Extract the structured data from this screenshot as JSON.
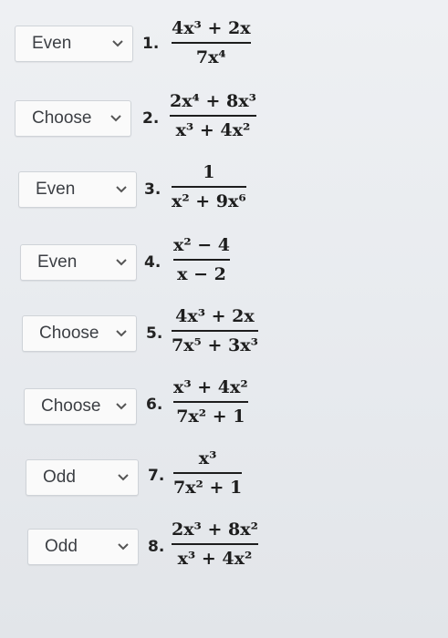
{
  "questions": [
    {
      "number": "1.",
      "answer": "Even",
      "numerator": "4x³ + 2x",
      "denominator": "7x⁴"
    },
    {
      "number": "2.",
      "answer": "Choose",
      "numerator": "2x⁴ + 8x³",
      "denominator": "x³ + 4x²"
    },
    {
      "number": "3.",
      "answer": "Even",
      "numerator": "1",
      "denominator": "x² + 9x⁶"
    },
    {
      "number": "4.",
      "answer": "Even",
      "numerator": "x² − 4",
      "denominator": "x − 2"
    },
    {
      "number": "5.",
      "answer": "Choose",
      "numerator": "4x³ + 2x",
      "denominator": "7x⁵ + 3x³"
    },
    {
      "number": "6.",
      "answer": "Choose",
      "numerator": "x³ + 4x²",
      "denominator": "7x² + 1"
    },
    {
      "number": "7.",
      "answer": "Odd",
      "numerator": "x³",
      "denominator": "7x² + 1"
    },
    {
      "number": "8.",
      "answer": "Odd",
      "numerator": "2x³ + 8x²",
      "denominator": "x³ + 4x²"
    }
  ],
  "icons": {
    "dropdown": "chevron-down-icon"
  },
  "colors": {
    "background": "#e8ebee",
    "select_bg": "#fafafa",
    "select_border": "#cfd3d8",
    "text": "#3c3f44",
    "math": "#1d1d1d"
  }
}
